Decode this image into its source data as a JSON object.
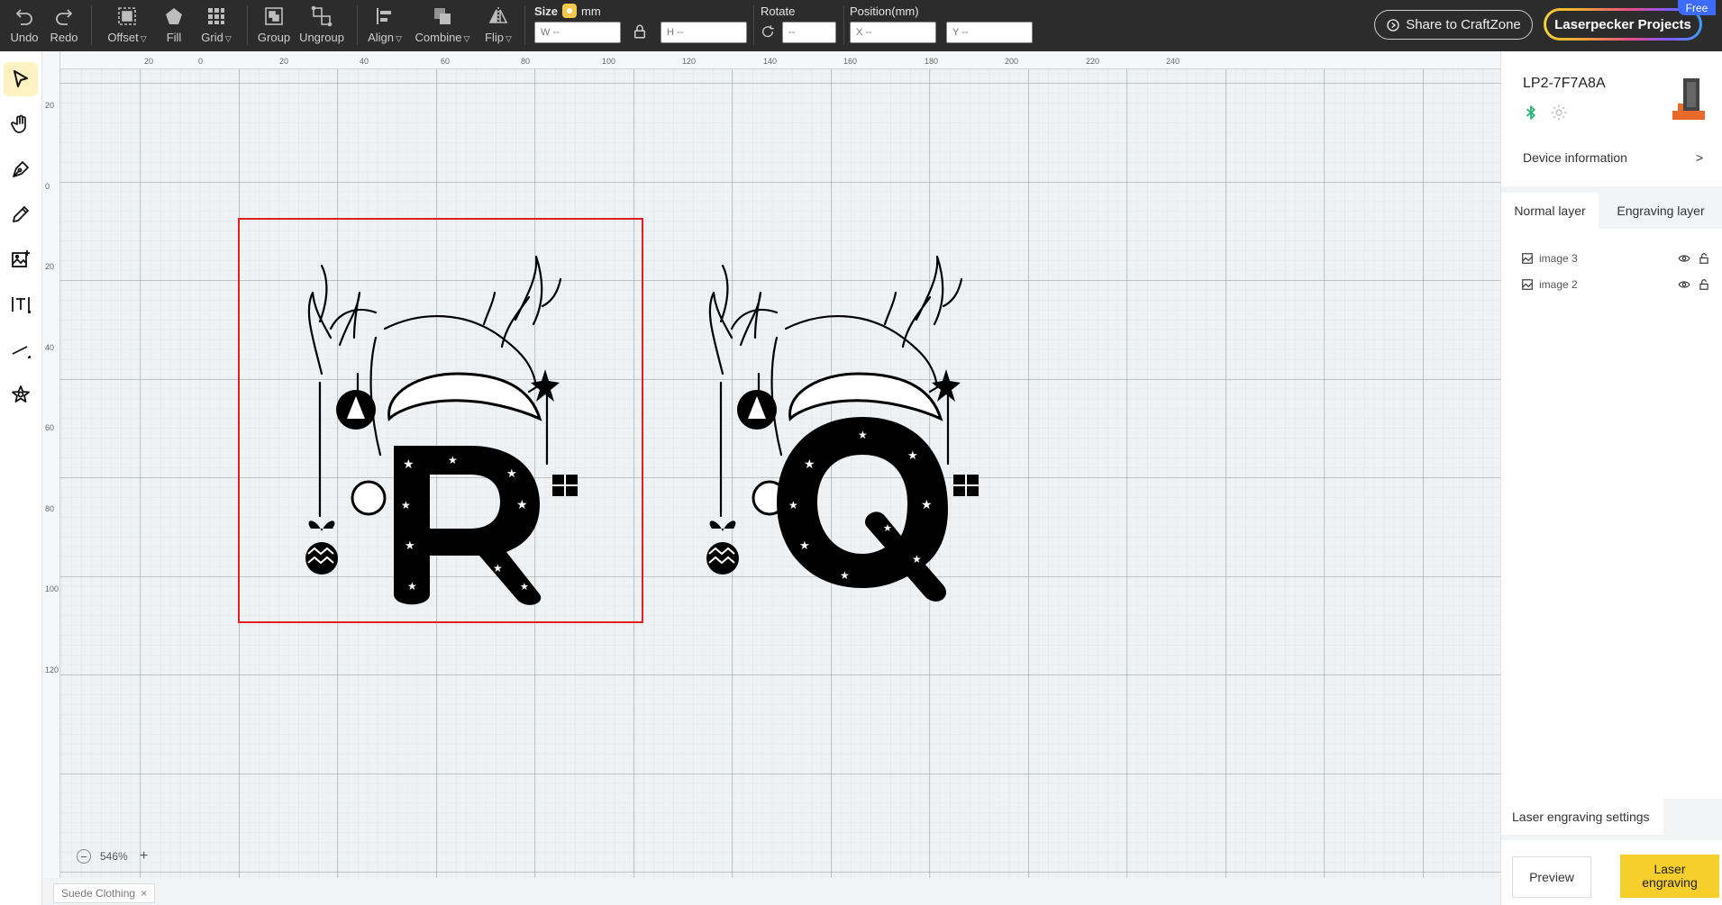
{
  "toolbar": {
    "undo": "Undo",
    "redo": "Redo",
    "offset": "Offset",
    "fill": "Fill",
    "grid": "Grid",
    "group": "Group",
    "ungroup": "Ungroup",
    "align": "Align",
    "combine": "Combine",
    "flip": "Flip",
    "size_label": "Size",
    "size_unit": "mm",
    "width_placeholder": "W --",
    "height_placeholder": "H --",
    "rotate_label": "Rotate",
    "rotate_placeholder": "--",
    "position_label": "Position(mm)",
    "x_placeholder": "X --",
    "y_placeholder": "Y --",
    "share": "Share to CraftZone",
    "projects": "Laserpecker Projects",
    "free_badge": "Free"
  },
  "ruler": {
    "top": [
      "20",
      "0",
      "20",
      "40",
      "60",
      "80",
      "100",
      "120",
      "140",
      "160",
      "180",
      "200",
      "220",
      "240"
    ],
    "left": [
      "20",
      "0",
      "20",
      "40",
      "60",
      "80",
      "100",
      "120"
    ]
  },
  "canvas": {
    "zoom": "546%",
    "tab": "Suede Clothing"
  },
  "device": {
    "name": "LP2-7F7A8A",
    "info": "Device information"
  },
  "layers": {
    "tab_normal": "Normal layer",
    "tab_engraving": "Engraving layer",
    "items": [
      {
        "name": "image 3"
      },
      {
        "name": "image 2"
      }
    ]
  },
  "settings": {
    "title": "Laser engraving settings",
    "preview": "Preview",
    "engrave": "Laser\nengraving"
  },
  "colors": {
    "accent": "#f7cf2c",
    "toolbar_bg": "#2c2c2c",
    "selection": "#e02020",
    "bluetooth": "#2bb673"
  }
}
